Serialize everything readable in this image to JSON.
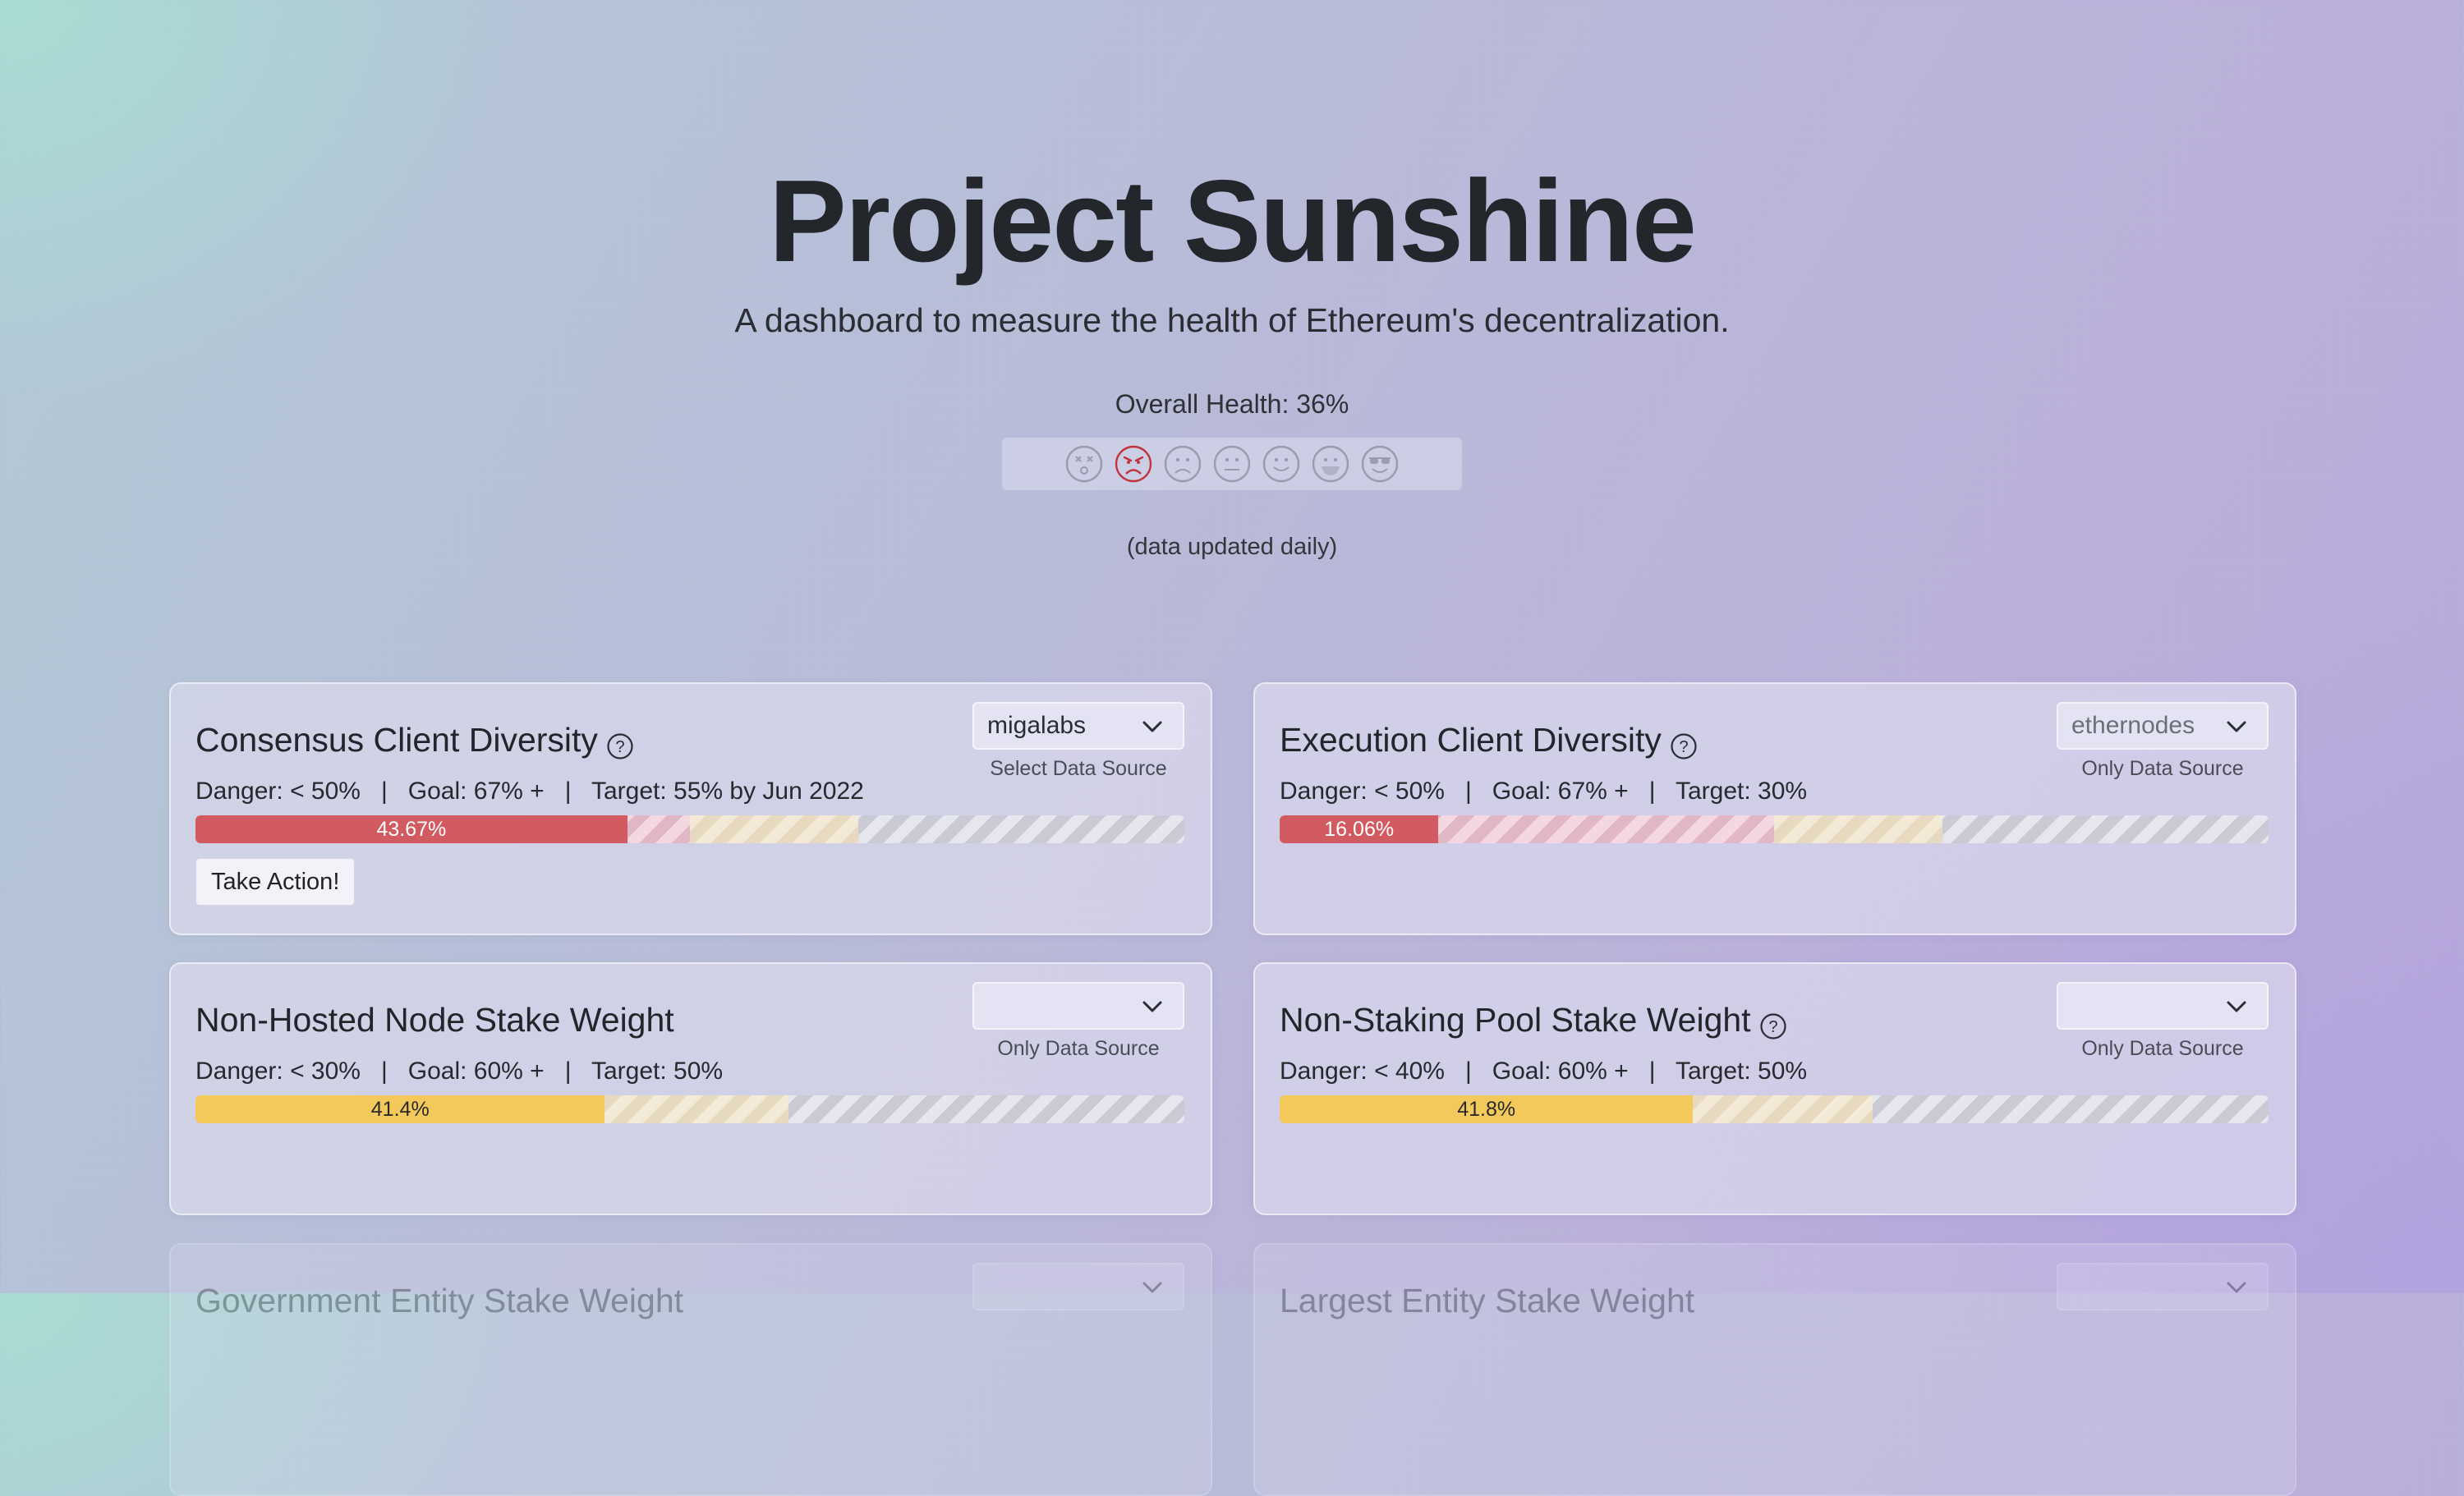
{
  "header": {
    "title": "Project Sunshine",
    "subtitle": "A dashboard to measure the health of Ethereum's decentralization.",
    "overall_health_label": "Overall Health: 36%",
    "overall_health": {
      "percent": 36,
      "selected_face_index": 1
    },
    "faces": [
      "dizzy-face-icon",
      "angry-face-icon",
      "frowning-face-icon",
      "neutral-face-icon",
      "slight-smile-icon",
      "grinning-face-icon",
      "sunglasses-face-icon"
    ],
    "updated_note": "(data updated daily)"
  },
  "colors": {
    "danger": "#d25a61",
    "warning": "#f3c95b",
    "selected_face": "#c0343c",
    "face_default": "#9a9cad"
  },
  "cards": [
    {
      "title": "Consensus Client Diversity",
      "has_help": true,
      "source": {
        "value": "migalabs",
        "caption": "Select Data Source",
        "enabled": true
      },
      "thresholds": "Danger: < 50%   |   Goal: 67% +   |   Target: 55% by Jun 2022",
      "progress": {
        "value": 43.67,
        "label": "43.67%",
        "color": "red",
        "danger": 50,
        "goal": 67
      },
      "action_label": "Take Action!"
    },
    {
      "title": "Execution Client Diversity",
      "has_help": true,
      "source": {
        "value": "ethernodes",
        "caption": "Only Data Source",
        "enabled": false
      },
      "thresholds": "Danger: < 50%   |   Goal: 67% +   |   Target: 30%",
      "progress": {
        "value": 16.06,
        "label": "16.06%",
        "color": "red",
        "danger": 50,
        "goal": 67
      }
    },
    {
      "title": "Non-Hosted Node Stake Weight",
      "has_help": false,
      "source": {
        "value": "",
        "caption": "Only Data Source",
        "enabled": false
      },
      "thresholds": "Danger: < 30%   |   Goal: 60% +   |   Target: 50%",
      "progress": {
        "value": 41.4,
        "label": "41.4%",
        "color": "yellow",
        "danger": 30,
        "goal": 60
      }
    },
    {
      "title": "Non-Staking Pool Stake Weight",
      "has_help": true,
      "source": {
        "value": "",
        "caption": "Only Data Source",
        "enabled": false
      },
      "thresholds": "Danger: < 40%   |   Goal: 60% +   |   Target: 50%",
      "progress": {
        "value": 41.8,
        "label": "41.8%",
        "color": "yellow",
        "danger": 40,
        "goal": 60
      }
    },
    {
      "title": "Government Entity Stake Weight"
    },
    {
      "title": "Largest Entity Stake Weight"
    }
  ]
}
